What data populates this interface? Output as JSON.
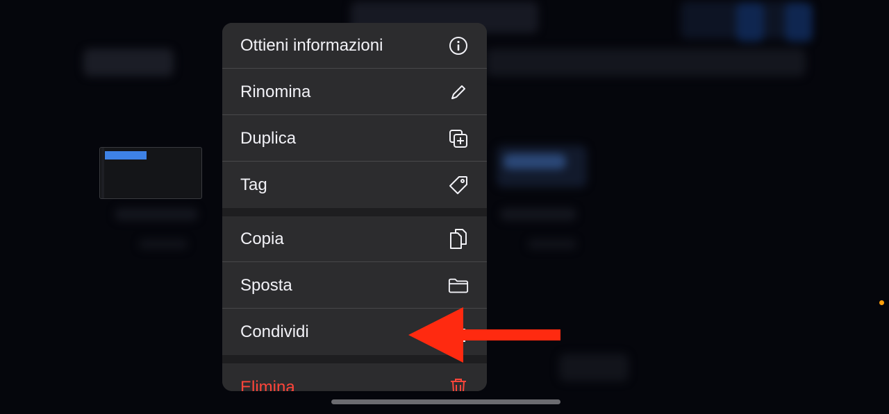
{
  "menu": {
    "items": [
      {
        "label": "Ottieni informazioni",
        "icon": "info-circle-icon"
      },
      {
        "label": "Rinomina",
        "icon": "pencil-icon"
      },
      {
        "label": "Duplica",
        "icon": "duplicate-plus-icon"
      },
      {
        "label": "Tag",
        "icon": "tag-icon"
      },
      {
        "label": "Copia",
        "icon": "copy-documents-icon"
      },
      {
        "label": "Sposta",
        "icon": "folder-icon"
      },
      {
        "label": "Condividi",
        "icon": "share-icon"
      },
      {
        "label": "Elimina",
        "icon": "trash-icon"
      }
    ]
  },
  "colors": {
    "menu_background": "#2c2c2e",
    "menu_text": "#f2f2f7",
    "destructive": "#ff453a",
    "annotation_arrow": "#ff2a10",
    "selection_blue": "#3e82e6"
  }
}
